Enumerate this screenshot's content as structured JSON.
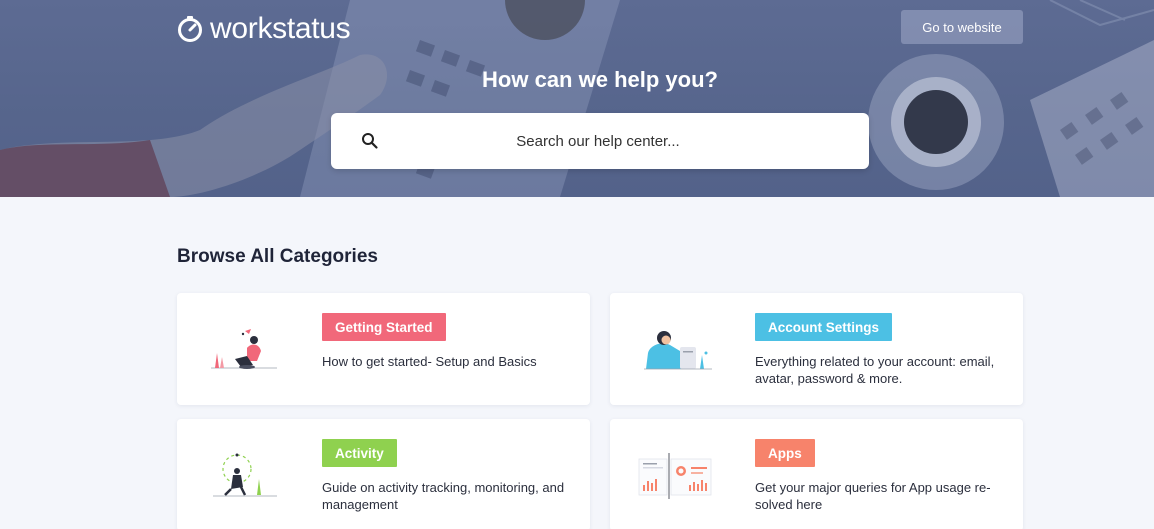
{
  "header": {
    "logo_text": "workstatus",
    "go_button": "Go to website",
    "title": "How can we help you?",
    "search_placeholder": "Search our help center..."
  },
  "main": {
    "section_title": "Browse All Categories",
    "categories": [
      {
        "label": "Getting Started",
        "description": "How to get started- Setup and Basics",
        "color": "#f1687a"
      },
      {
        "label": "Account Settings",
        "description": "Everything related to your account: email, avatar, password & more.",
        "color": "#4cc0e4"
      },
      {
        "label": "Activity",
        "description": "Guide on activity tracking, monitoring, and management",
        "color": "#8fd14f"
      },
      {
        "label": "Apps",
        "description": "Get your major queries for App usage re-solved here",
        "color": "#f7836b"
      }
    ]
  },
  "colors": {
    "hero": "#5a6890",
    "background": "#f4f6fb"
  }
}
